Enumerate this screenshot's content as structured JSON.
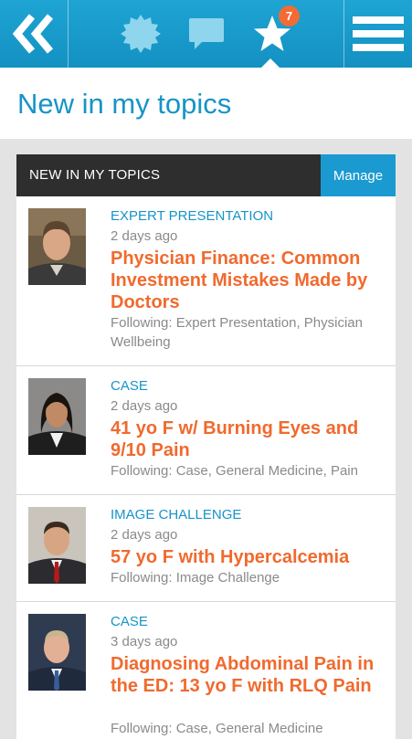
{
  "topbar": {
    "back_icon": "double-chevron-left-icon",
    "badge_icon": "seal-badge-icon",
    "chat_icon": "speech-bubble-icon",
    "star_icon": "star-icon",
    "star_badge_count": "7",
    "menu_icon": "hamburger-menu-icon"
  },
  "page": {
    "title": "New in my topics"
  },
  "panel": {
    "title": "NEW IN MY TOPICS",
    "manage_label": "Manage"
  },
  "items": [
    {
      "category": "EXPERT PRESENTATION",
      "ago": "2 days ago",
      "title": "Physician Finance: Common Investment Mistakes Made by Doctors",
      "following": "Following: Expert Presentation, Physician Wellbeing"
    },
    {
      "category": "CASE",
      "ago": "2 days ago",
      "title": "41 yo F w/ Burning Eyes and 9/10 Pain",
      "following": "Following: Case, General Medicine, Pain"
    },
    {
      "category": "IMAGE CHALLENGE",
      "ago": "2 days ago",
      "title": "57 yo F with Hypercalcemia",
      "following": "Following: Image Challenge"
    },
    {
      "category": "CASE",
      "ago": "3 days ago",
      "title": "Diagnosing Abdominal Pain in the ED: 13 yo F with RLQ Pain",
      "following": "Following: Case, General Medicine"
    }
  ],
  "colors": {
    "brand_blue": "#1694c6",
    "title_orange": "#f06a2e",
    "badge_orange": "#f26b35",
    "header_dark": "#2e2e2e"
  }
}
